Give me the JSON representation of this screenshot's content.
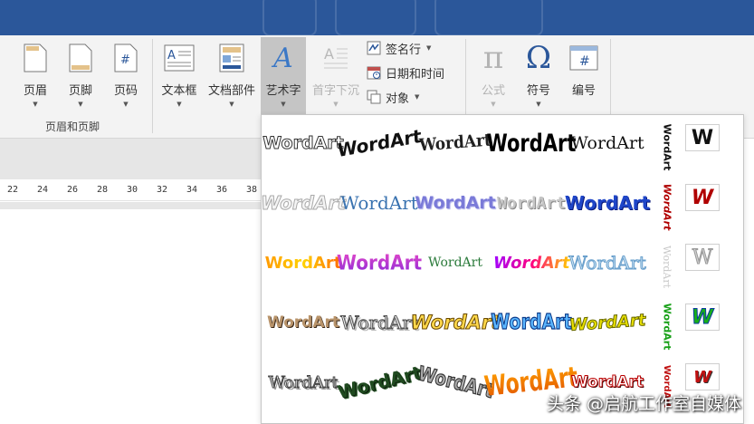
{
  "ribbon": {
    "header_footer": {
      "header": "页眉",
      "footer": "页脚",
      "page_number": "页码",
      "group_label": "页眉和页脚"
    },
    "text": {
      "textbox": "文本框",
      "doc_parts": "文档部件",
      "wordart": "艺术字",
      "dropcap": "首字下沉",
      "signature_line": "签名行",
      "date_time": "日期和时间",
      "object": "对象"
    },
    "symbols": {
      "equation": "公式",
      "symbol": "符号",
      "numbering": "编号",
      "pi_glyph": "π",
      "omega_glyph": "Ω",
      "hash_glyph": "#"
    },
    "dropdown_glyph": "▼",
    "textbox_glyph": "A",
    "wordart_glyph": "A"
  },
  "ruler": {
    "ticks": [
      "22",
      "24",
      "26",
      "28",
      "30",
      "32",
      "34",
      "36",
      "38"
    ]
  },
  "gallery": {
    "label": "WordArt",
    "side_letter": "W"
  },
  "watermark": "头条 @启航工作室自媒体",
  "colors": {
    "titlebar": "#2b579a",
    "ribbon_bg": "#f3f3f3",
    "active_button": "#c5c5c5",
    "accent_blue": "#2b579a"
  }
}
